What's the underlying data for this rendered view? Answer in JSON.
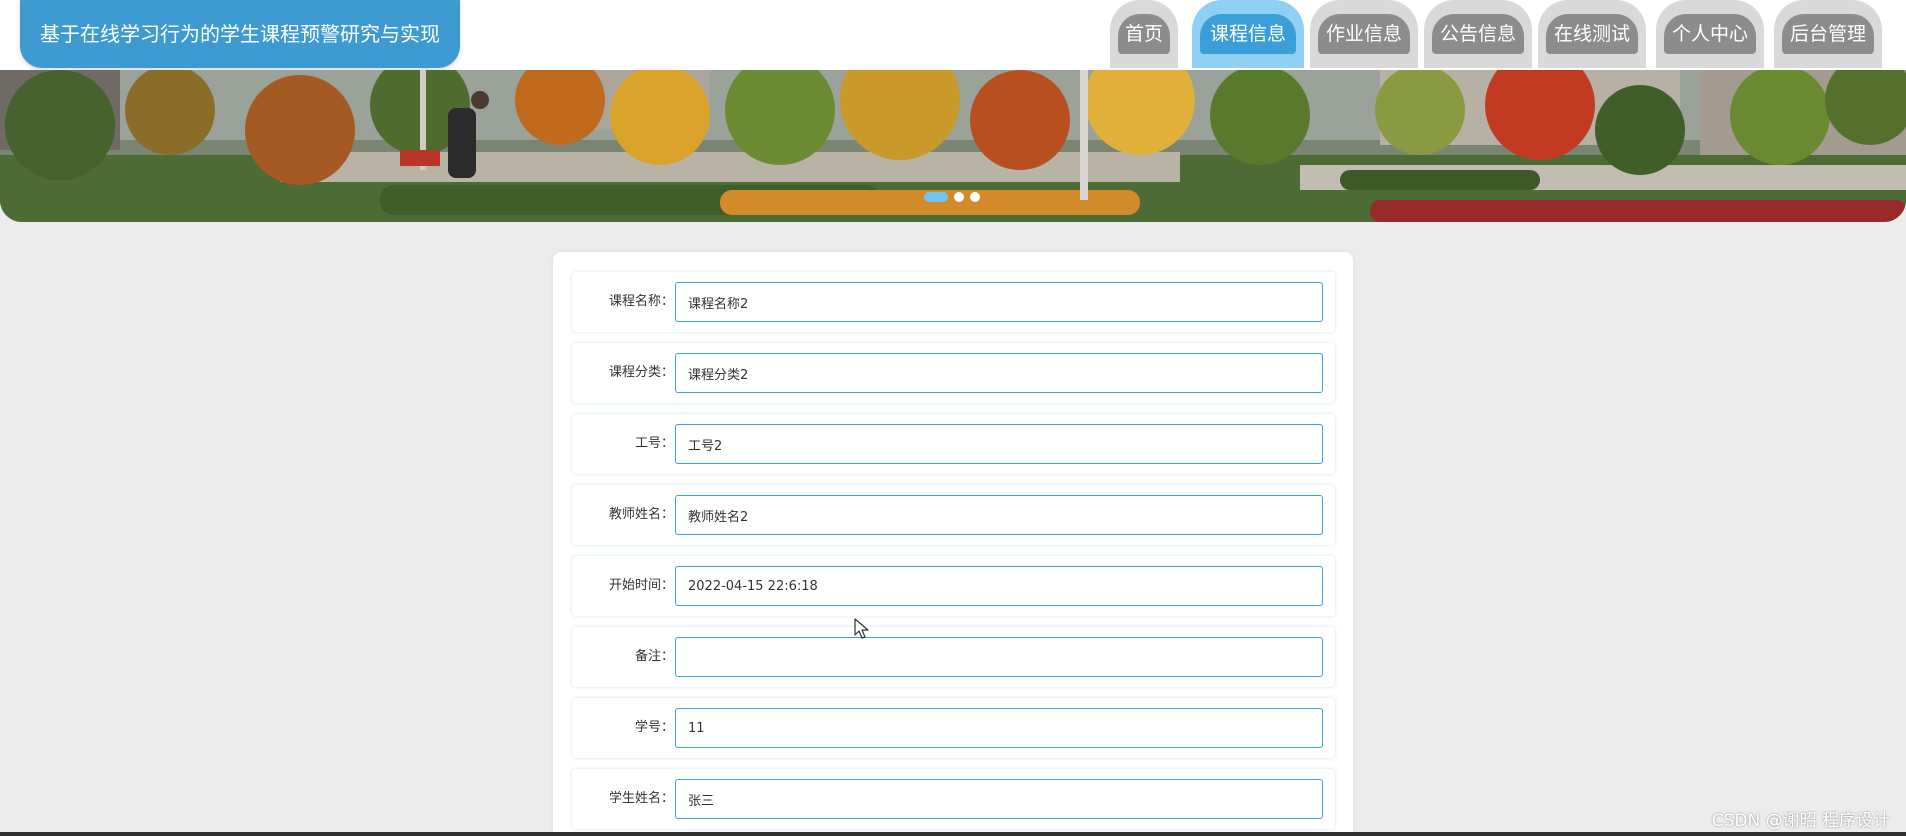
{
  "header": {
    "site_title": "基于在线学习行为的学生课程预警研究与实现"
  },
  "nav": {
    "tabs": [
      {
        "label": "首页",
        "active": false
      },
      {
        "label": "课程信息",
        "active": true
      },
      {
        "label": "作业信息",
        "active": false
      },
      {
        "label": "公告信息",
        "active": false
      },
      {
        "label": "在线测试",
        "active": false
      },
      {
        "label": "个人中心",
        "active": false
      },
      {
        "label": "后台管理",
        "active": false
      }
    ]
  },
  "banner": {
    "slide_count": 3,
    "active_slide": 1
  },
  "form": {
    "fields": [
      {
        "label": "课程名称：",
        "value": "课程名称2"
      },
      {
        "label": "课程分类：",
        "value": "课程分类2"
      },
      {
        "label": "工号：",
        "value": "工号2"
      },
      {
        "label": "教师姓名：",
        "value": "教师姓名2"
      },
      {
        "label": "开始时间：",
        "value": "2022-04-15 22:6:18"
      },
      {
        "label": "备注：",
        "value": ""
      },
      {
        "label": "学号：",
        "value": "11"
      },
      {
        "label": "学生姓名：",
        "value": "张三"
      }
    ]
  },
  "watermark": "CSDN @谢昭  程序设计",
  "colors": {
    "accent": "#3a9fd8",
    "tab_inactive": "#8c8c8c",
    "background": "#ececec"
  }
}
